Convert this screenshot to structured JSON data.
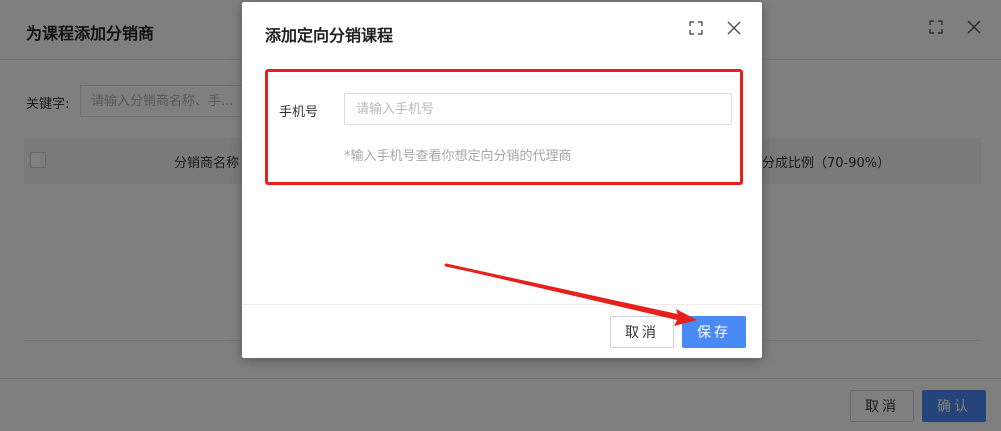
{
  "outer_dialog": {
    "title": "为课程添加分销商",
    "keyword_label": "关键字:",
    "keyword_placeholder": "请输入分销商名称、手...",
    "keyword_value": "",
    "table_headers": {
      "name": "分销商名称",
      "ratio": "分成比例（70-90%）"
    },
    "cancel_label": "取消",
    "confirm_label": "确认"
  },
  "inner_dialog": {
    "title": "添加定向分销课程",
    "phone_label": "手机号",
    "phone_placeholder": "请输入手机号",
    "phone_value": "",
    "phone_hint": "*输入手机号查看你想定向分销的代理商",
    "cancel_label": "取消",
    "save_label": "保存"
  },
  "icons": {
    "expand": "expand-icon",
    "close": "close-icon"
  },
  "colors": {
    "primary": "#4a8af4",
    "annotation_red": "#e8201c"
  }
}
